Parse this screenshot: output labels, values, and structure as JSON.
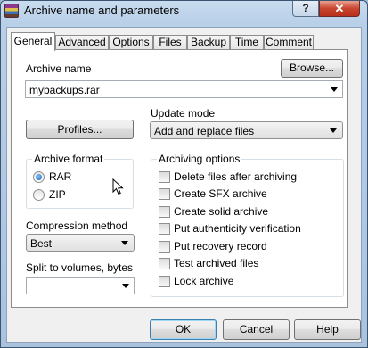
{
  "window": {
    "title": "Archive name and parameters",
    "help_glyph": "?",
    "close_glyph": "✕",
    "icon": "winrar-icon"
  },
  "tabs": [
    {
      "label": "General",
      "active": true
    },
    {
      "label": "Advanced",
      "active": false
    },
    {
      "label": "Options",
      "active": false
    },
    {
      "label": "Files",
      "active": false
    },
    {
      "label": "Backup",
      "active": false
    },
    {
      "label": "Time",
      "active": false
    },
    {
      "label": "Comment",
      "active": false
    }
  ],
  "general": {
    "archive_name_label": "Archive name",
    "browse_label": "Browse...",
    "archive_name_value": "mybackups.rar",
    "profiles_label": "Profiles...",
    "update_mode_label": "Update mode",
    "update_mode_value": "Add and replace files",
    "archive_format": {
      "title": "Archive format",
      "options": [
        {
          "label": "RAR",
          "checked": true
        },
        {
          "label": "ZIP",
          "checked": false
        }
      ]
    },
    "compression_method_label": "Compression method",
    "compression_method_value": "Best",
    "split_label": "Split to volumes, bytes",
    "split_value": "",
    "archiving_options": {
      "title": "Archiving options",
      "items": [
        {
          "label": "Delete files after archiving",
          "checked": false
        },
        {
          "label": "Create SFX archive",
          "checked": false
        },
        {
          "label": "Create solid archive",
          "checked": false
        },
        {
          "label": "Put authenticity verification",
          "checked": false
        },
        {
          "label": "Put recovery record",
          "checked": false
        },
        {
          "label": "Test archived files",
          "checked": false
        },
        {
          "label": "Lock archive",
          "checked": false
        }
      ]
    }
  },
  "footer": {
    "ok_label": "OK",
    "cancel_label": "Cancel",
    "help_label": "Help"
  }
}
